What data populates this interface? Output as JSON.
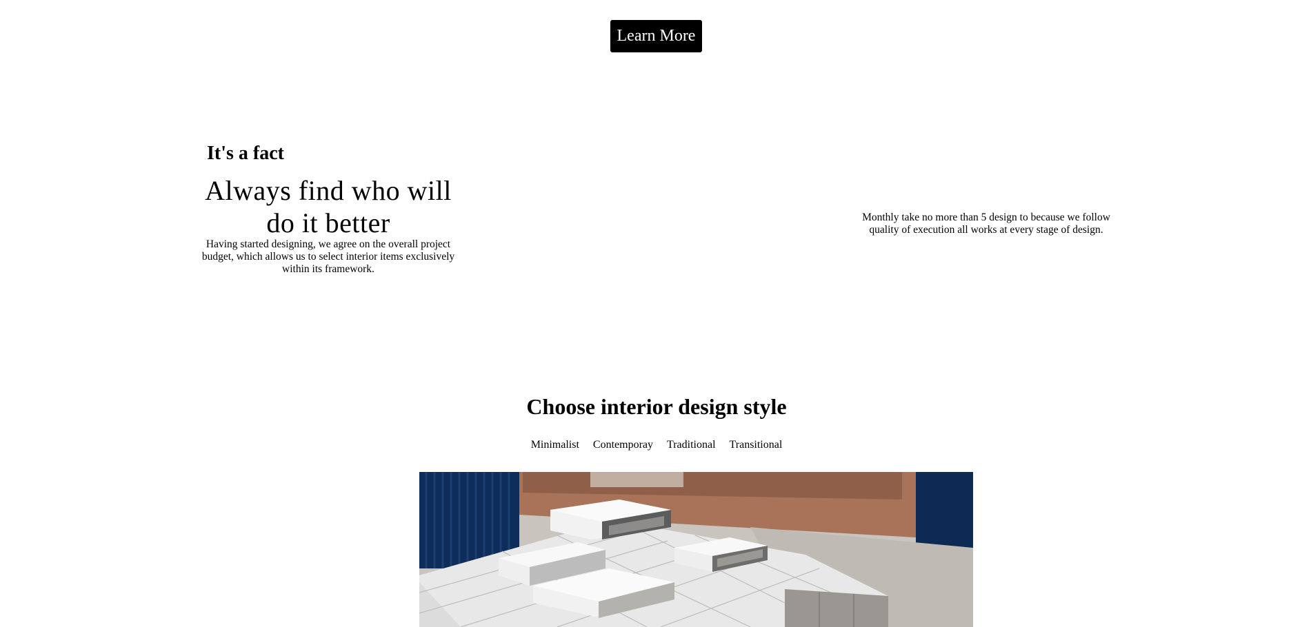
{
  "cta": {
    "label": "Learn More"
  },
  "fact": {
    "eyebrow": "It's a fact",
    "heading": "Always find who will do it better",
    "body": "Having started designing, we agree on the overall project budget, which allows us to select interior items exclusively within its framework."
  },
  "note": {
    "text": "Monthly take no more than 5 design to because we follow quality of execution all works at every stage of design."
  },
  "styles": {
    "title": "Choose interior design style",
    "tabs": [
      {
        "label": "Minimalist"
      },
      {
        "label": "Contemporay"
      },
      {
        "label": "Traditional"
      },
      {
        "label": "Transitional"
      }
    ]
  },
  "hero": {
    "colors": {
      "blue": "#0f2d5a",
      "terracotta": "#b07a5e",
      "floor": "#c9c4be",
      "block": "#ececec",
      "shadow": "#a9a6a3"
    }
  }
}
